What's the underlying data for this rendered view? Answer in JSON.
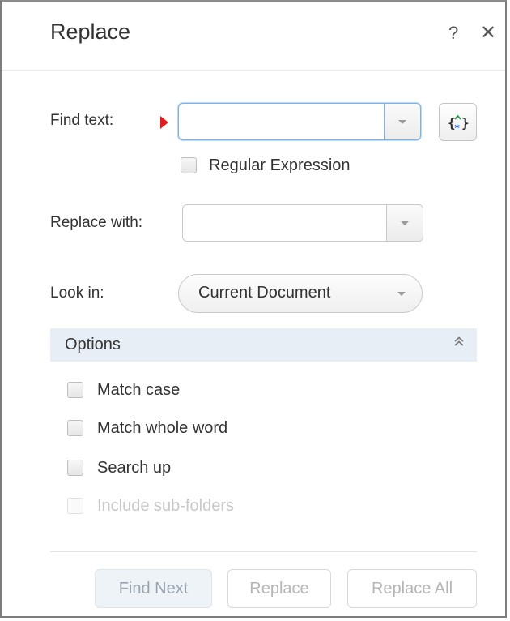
{
  "dialog": {
    "title": "Replace",
    "help_label": "?",
    "close_label": "✕"
  },
  "find": {
    "label": "Find text:",
    "value": "",
    "regex_checkbox_label": "Regular Expression",
    "regex_checked": false
  },
  "replace": {
    "label": "Replace with:",
    "value": ""
  },
  "look_in": {
    "label": "Look in:",
    "value": "Current Document"
  },
  "options": {
    "header": "Options",
    "collapse_glyph": "︽",
    "items": [
      {
        "label": "Match case",
        "checked": false,
        "enabled": true
      },
      {
        "label": "Match whole word",
        "checked": false,
        "enabled": true
      },
      {
        "label": "Search up",
        "checked": false,
        "enabled": true
      },
      {
        "label": "Include sub-folders",
        "checked": false,
        "enabled": false
      }
    ]
  },
  "buttons": {
    "find_next": "Find Next",
    "replace": "Replace",
    "replace_all": "Replace All"
  },
  "colors": {
    "required_marker": "#e31b1b",
    "focus_border": "#7fb2e6",
    "options_bar": "#e8eef5"
  }
}
